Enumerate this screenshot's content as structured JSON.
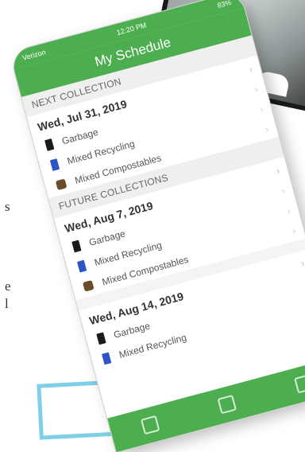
{
  "status_bar": {
    "carrier": "Verizon",
    "time": "12:20 PM",
    "battery": "83%"
  },
  "navbar": {
    "title": "My Schedule"
  },
  "next_collection": {
    "header": "NEXT COLLECTION",
    "date": "Wed, Jul 31, 2019",
    "items": [
      {
        "label": "Garbage",
        "icon": "garbage-bin-icon"
      },
      {
        "label": "Mixed Recycling",
        "icon": "recycling-bin-icon"
      },
      {
        "label": "Mixed Compostables",
        "icon": "compost-bin-icon"
      }
    ]
  },
  "future_collections": {
    "header": "FUTURE COLLECTIONS",
    "groups": [
      {
        "date": "Wed, Aug 7, 2019",
        "items": [
          {
            "label": "Garbage",
            "icon": "garbage-bin-icon"
          },
          {
            "label": "Mixed Recycling",
            "icon": "recycling-bin-icon"
          },
          {
            "label": "Mixed Compostables",
            "icon": "compost-bin-icon"
          }
        ]
      },
      {
        "date": "Wed, Aug 14, 2019",
        "items": [
          {
            "label": "Garbage",
            "icon": "garbage-bin-icon"
          },
          {
            "label": "Mixed Recycling",
            "icon": "recycling-bin-icon"
          }
        ]
      }
    ]
  },
  "side_text": {
    "letters": [
      "s",
      "e",
      "l"
    ]
  },
  "colors": {
    "brand_green": "#4cae4f",
    "garbage": "#1b1b1b",
    "recycling": "#2f53c8",
    "compost": "#6b4c2a"
  }
}
